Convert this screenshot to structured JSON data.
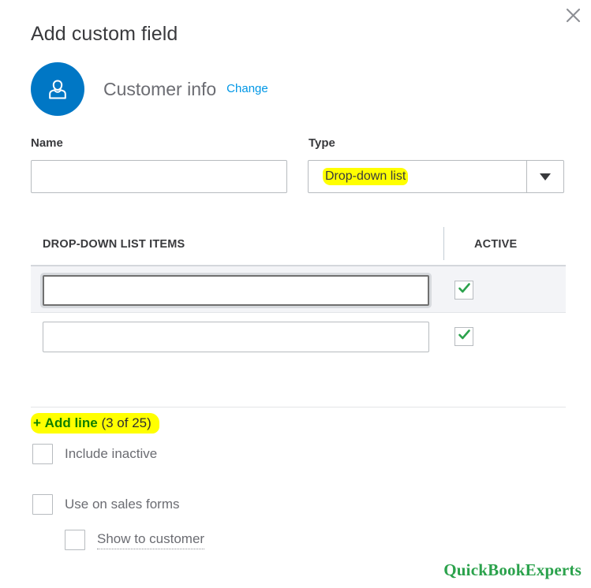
{
  "window": {
    "close_label": "×"
  },
  "header": {
    "title": "Add custom field"
  },
  "entity": {
    "icon": "person-avatar-icon",
    "name": "Customer info",
    "change_link": "Change"
  },
  "form": {
    "name": {
      "label": "Name",
      "value": "",
      "placeholder": ""
    },
    "type": {
      "label": "Type",
      "value": "Drop-down list",
      "highlighted": true,
      "arrow_icon": "chevron-down-icon"
    }
  },
  "table": {
    "columns": [
      "DROP-DOWN LIST ITEMS",
      "ACTIVE"
    ],
    "rows": [
      {
        "value": "",
        "placeholder": "",
        "active": true,
        "active_icon": "check-icon",
        "focused": true,
        "selected": true
      },
      {
        "value": "",
        "placeholder": "",
        "active": true,
        "active_icon": "check-icon",
        "focused": false,
        "selected": false
      }
    ]
  },
  "add_line": {
    "plus": "+",
    "label": "Add line",
    "count": "(3 of 25)",
    "highlighted": true
  },
  "options": [
    {
      "label": "Include inactive",
      "checked": false
    },
    {
      "label": "Use on sales forms",
      "checked": false
    },
    {
      "label": "Show to customer",
      "checked": false,
      "dotted_underline": true
    }
  ],
  "watermark": {
    "text": "QuickBookExperts"
  },
  "colors": {
    "accent_blue": "#0077c5",
    "link_blue": "#0097e6",
    "green": "#108000",
    "check_green": "#2ba24c",
    "highlight_yellow": "#ffff00",
    "row_selected": "#f3f4f7",
    "border_gray": "#b7bbbf",
    "text_dark": "#393a3d",
    "text_muted": "#6b6c72",
    "watermark_green": "#2ba24c"
  }
}
